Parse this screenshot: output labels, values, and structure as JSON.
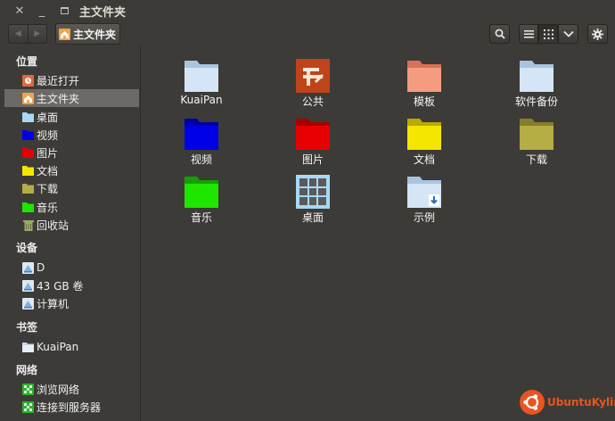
{
  "window": {
    "title": "主文件夹",
    "close_glyph": "✕",
    "min_glyph": "_"
  },
  "toolbar": {
    "back_glyph": "◀",
    "forward_glyph": "▶",
    "breadcrumb": "主文件夹",
    "search_icon": "search-icon",
    "list_view_icon": "list-view-icon",
    "grid_view_icon": "grid-view-icon",
    "dropdown_icon": "chevron-down-icon",
    "settings_icon": "gear-icon",
    "active_view": "grid"
  },
  "sidebar": {
    "sections": [
      {
        "title": "位置",
        "items": [
          {
            "label": "最近打开",
            "icon": "recent-icon",
            "color": "#e06a3a"
          },
          {
            "label": "主文件夹",
            "icon": "home-icon",
            "color": "#f2a24a",
            "selected": true
          },
          {
            "label": "桌面",
            "icon": "desktop-folder-icon",
            "color": "#a8d8f5"
          },
          {
            "label": "视频",
            "icon": "videos-folder-icon",
            "color": "#0000e6"
          },
          {
            "label": "图片",
            "icon": "pictures-folder-icon",
            "color": "#e60000"
          },
          {
            "label": "文档",
            "icon": "documents-folder-icon",
            "color": "#f5e600"
          },
          {
            "label": "下载",
            "icon": "downloads-folder-icon",
            "color": "#b5ad45"
          },
          {
            "label": "音乐",
            "icon": "music-folder-icon",
            "color": "#1ee600"
          },
          {
            "label": "回收站",
            "icon": "trash-icon",
            "color": "#9aa86a"
          }
        ]
      },
      {
        "title": "设备",
        "items": [
          {
            "label": "D",
            "icon": "drive-icon",
            "color": "#7fb0e0"
          },
          {
            "label": "43 GB 卷",
            "icon": "drive-icon",
            "color": "#7fb0e0"
          },
          {
            "label": "计算机",
            "icon": "computer-icon",
            "color": "#7fb0e0"
          }
        ]
      },
      {
        "title": "书签",
        "items": [
          {
            "label": "KuaiPan",
            "icon": "bookmark-folder-icon",
            "color": "#c8d8ec"
          }
        ]
      },
      {
        "title": "网络",
        "items": [
          {
            "label": "浏览网络",
            "icon": "network-icon",
            "color": "#2fb02f"
          },
          {
            "label": "连接到服务器",
            "icon": "server-icon",
            "color": "#2fb02f"
          }
        ]
      }
    ]
  },
  "files": [
    {
      "label": "KuaiPan",
      "icon": "folder-icon",
      "color": "#c7dcf1"
    },
    {
      "label": "公共",
      "icon": "public-folder-icon",
      "color": "#c0441a"
    },
    {
      "label": "模板",
      "icon": "templates-folder-icon",
      "color": "#f08c6c"
    },
    {
      "label": "软件备份",
      "icon": "folder-icon",
      "color": "#c7dcf1"
    },
    {
      "label": "视频",
      "icon": "videos-folder-icon",
      "color": "#0000e6"
    },
    {
      "label": "图片",
      "icon": "pictures-folder-icon",
      "color": "#e60000"
    },
    {
      "label": "文档",
      "icon": "documents-folder-icon",
      "color": "#f5e600"
    },
    {
      "label": "下载",
      "icon": "downloads-folder-icon",
      "color": "#b5ad45"
    },
    {
      "label": "音乐",
      "icon": "music-folder-icon",
      "color": "#1ee600"
    },
    {
      "label": "桌面",
      "icon": "desktop-folder-icon",
      "color": "#a8d8f5"
    },
    {
      "label": "示例",
      "icon": "examples-folder-icon",
      "color": "#c7dcf1"
    }
  ],
  "branding": {
    "text": "UbuntuKylin",
    "color": "#e95420"
  }
}
